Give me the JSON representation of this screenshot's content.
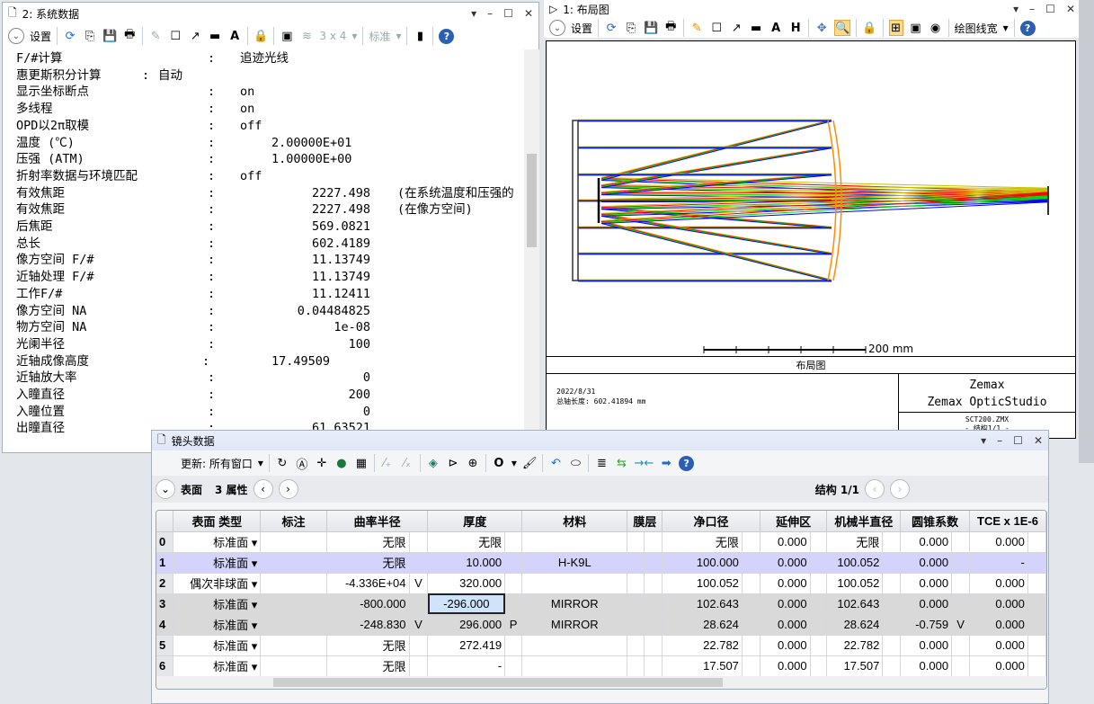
{
  "system_window": {
    "title": "2: 系统数据",
    "toolbar": {
      "settings": "设置",
      "grid": "3 x 4",
      "standard": "标准"
    },
    "rows": [
      {
        "label": "F/#计算",
        "value": "追迹光线"
      },
      {
        "label": "惠更斯积分计算",
        "value": "自动"
      },
      {
        "label": "显示坐标断点",
        "value": "on"
      },
      {
        "label": "多线程",
        "value": "on"
      },
      {
        "label": "OPD以2π取模",
        "value": "off"
      },
      {
        "label": "温度 (℃)",
        "value": "2.00000E+01"
      },
      {
        "label": "压强 (ATM)",
        "value": "1.00000E+00"
      },
      {
        "label": "折射率数据与环境匹配",
        "value": "off"
      },
      {
        "label": "有效焦距",
        "value": "2227.498",
        "note": "(在系统温度和压强的"
      },
      {
        "label": "有效焦距",
        "value": "2227.498",
        "note": " (在像方空间)"
      },
      {
        "label": "后焦距",
        "value": "569.0821"
      },
      {
        "label": "总长",
        "value": "602.4189"
      },
      {
        "label": "像方空间 F/#",
        "value": "11.13749"
      },
      {
        "label": "近轴处理 F/#",
        "value": "11.13749"
      },
      {
        "label": "工作F/#",
        "value": "11.12411"
      },
      {
        "label": "像方空间 NA",
        "value": "0.04484825"
      },
      {
        "label": "物方空间 NA",
        "value": "1e-08"
      },
      {
        "label": "光阑半径",
        "value": "100"
      },
      {
        "label": "近轴成像高度",
        "value": "17.49509"
      },
      {
        "label": "近轴放大率",
        "value": "0"
      },
      {
        "label": "入瞳直径",
        "value": "200"
      },
      {
        "label": "入瞳位置",
        "value": "0"
      },
      {
        "label": "出瞳直径",
        "value": "61.63521"
      }
    ]
  },
  "layout_window": {
    "title": "1: 布局图",
    "toolbar": {
      "settings": "设置",
      "line_width": "绘图线宽"
    },
    "scale_label": "200 mm",
    "plot_title": "布局图",
    "date": "2022/8/31",
    "total_length": "总轴长度:  602.41894 mm",
    "company": "Zemax",
    "product": "Zemax OpticStudio",
    "file": "SCT200.ZMX",
    "config": "- 结构1/1 -",
    "colors": {
      "ray_blue": "#0000ff",
      "ray_green": "#00dd00",
      "ray_red": "#ff0000",
      "ray_yellow": "#c8c000",
      "mirror": "#ff8c00"
    }
  },
  "lens_window": {
    "title": "镜头数据",
    "toolbar": {
      "update": "更新: 所有窗口"
    },
    "nav": {
      "surface": "表面",
      "props": "3 属性",
      "config": "结构 1/1"
    },
    "columns": [
      "表面 类型",
      "标注",
      "曲率半径",
      "厚度",
      "材料",
      "膜层",
      "净口径",
      "延伸区",
      "机械半直径",
      "圆锥系数",
      "TCE x 1E-6"
    ],
    "rows": [
      {
        "n": "0",
        "type": "标准面",
        "note": "",
        "r": "无限",
        "rs": "",
        "t": "无限",
        "ts": "",
        "mat": "",
        "clear": "无限",
        "ext": "0.000",
        "mech": "无限",
        "conic": "0.000",
        "cs": "",
        "tce": "0.000"
      },
      {
        "n": "1",
        "type": "标准面",
        "note": "",
        "r": "无限",
        "rs": "",
        "t": "10.000",
        "ts": "",
        "mat": "H-K9L",
        "clear": "100.000",
        "ext": "0.000",
        "mech": "100.052",
        "conic": "0.000",
        "cs": "",
        "tce": "-"
      },
      {
        "n": "2",
        "type": "偶次非球面",
        "note": "",
        "r": "-4.336E+04",
        "rs": "V",
        "t": "320.000",
        "ts": "",
        "mat": "",
        "clear": "100.052",
        "ext": "0.000",
        "mech": "100.052",
        "conic": "0.000",
        "cs": "",
        "tce": "0.000"
      },
      {
        "n": "3",
        "type": "标准面",
        "note": "",
        "r": "-800.000",
        "rs": "",
        "t": "-296.000",
        "ts": "",
        "mat": "MIRROR",
        "clear": "102.643",
        "ext": "0.000",
        "mech": "102.643",
        "conic": "0.000",
        "cs": "",
        "tce": "0.000"
      },
      {
        "n": "4",
        "type": "标准面",
        "note": "",
        "r": "-248.830",
        "rs": "V",
        "t": "296.000",
        "ts": "P",
        "mat": "MIRROR",
        "clear": "28.624",
        "ext": "0.000",
        "mech": "28.624",
        "conic": "-0.759",
        "cs": "V",
        "tce": "0.000"
      },
      {
        "n": "5",
        "type": "标准面",
        "note": "",
        "r": "无限",
        "rs": "",
        "t": "272.419",
        "ts": "",
        "mat": "",
        "clear": "22.782",
        "ext": "0.000",
        "mech": "22.782",
        "conic": "0.000",
        "cs": "",
        "tce": "0.000"
      },
      {
        "n": "6",
        "type": "标准面",
        "note": "",
        "r": "无限",
        "rs": "",
        "t": "-",
        "ts": "",
        "mat": "",
        "clear": "17.507",
        "ext": "0.000",
        "mech": "17.507",
        "conic": "0.000",
        "cs": "",
        "tce": "0.000"
      }
    ],
    "selected_row": "1",
    "active_cell": "3:thickness"
  }
}
